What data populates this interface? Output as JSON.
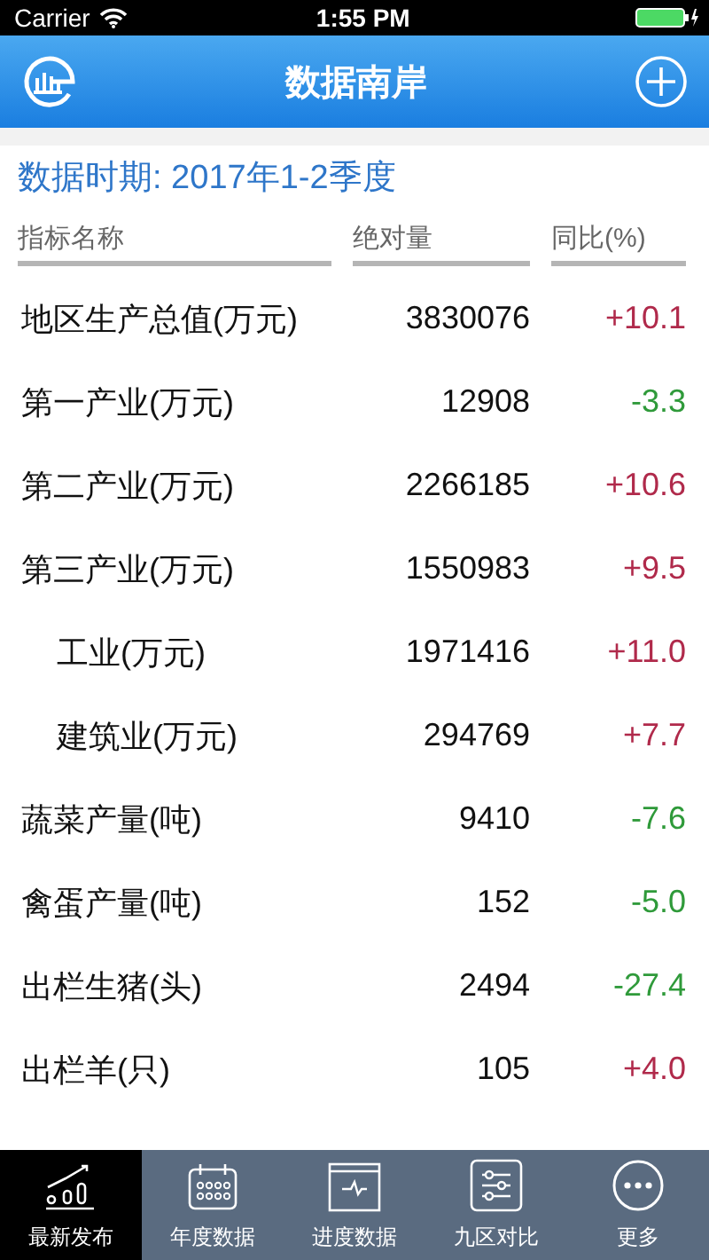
{
  "status_bar": {
    "carrier": "Carrier",
    "time": "1:55 PM"
  },
  "nav": {
    "title": "数据南岸"
  },
  "period": "数据时期: 2017年1-2季度",
  "table": {
    "columns": [
      "指标名称",
      "绝对量",
      "同比(%)"
    ],
    "rows": [
      {
        "name": "地区生产总值(万元)",
        "value": "3830076",
        "change": "+10.1",
        "color": "#b02a4b"
      },
      {
        "name": "第一产业(万元)",
        "value": "12908",
        "change": "-3.3",
        "color": "#2f9a3a"
      },
      {
        "name": "第二产业(万元)",
        "value": "2266185",
        "change": "+10.6",
        "color": "#b02a4b"
      },
      {
        "name": "第三产业(万元)",
        "value": "1550983",
        "change": "+9.5",
        "color": "#b02a4b",
        "children": [
          {
            "name": "工业(万元)",
            "value": "1971416",
            "change": "+11.0",
            "color": "#b02a4b"
          },
          {
            "name": "建筑业(万元)",
            "value": "294769",
            "change": "+7.7",
            "color": "#b02a4b"
          }
        ]
      },
      {
        "name": "蔬菜产量(吨)",
        "value": "9410",
        "change": "-7.6",
        "color": "#2f9a3a"
      },
      {
        "name": "禽蛋产量(吨)",
        "value": "152",
        "change": "-5.0",
        "color": "#2f9a3a"
      },
      {
        "name": "出栏生猪(头)",
        "value": "2494",
        "change": "-27.4",
        "color": "#2f9a3a"
      },
      {
        "name": "出栏羊(只)",
        "value": "105",
        "change": "+4.0",
        "color": "#b02a4b"
      }
    ]
  },
  "tab_bar": [
    {
      "label": "最新发布",
      "selected": true,
      "kind": "trend"
    },
    {
      "label": "年度数据",
      "selected": false,
      "kind": "calendar"
    },
    {
      "label": "进度数据",
      "selected": false,
      "kind": "monitor"
    },
    {
      "label": "九区对比",
      "selected": false,
      "kind": "sliders"
    },
    {
      "label": "更多",
      "selected": false,
      "kind": "more"
    }
  ]
}
